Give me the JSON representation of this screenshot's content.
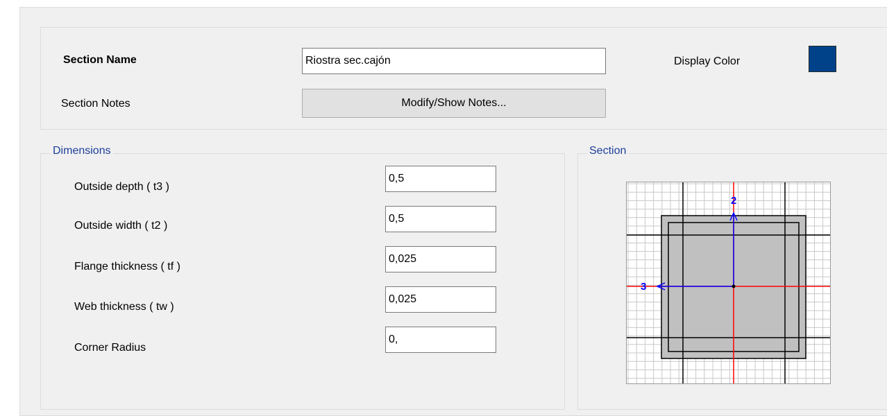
{
  "header": {
    "section_name_label": "Section Name",
    "section_name_value": "Riostra sec.cajón",
    "display_color_label": "Display Color",
    "display_color": "#00428a",
    "section_notes_label": "Section Notes",
    "notes_button_label": "Modify/Show Notes..."
  },
  "dimensions": {
    "title": "Dimensions",
    "fields": [
      {
        "label": "Outside depth  ( t3 )",
        "value": "0,5"
      },
      {
        "label": "Outside width  ( t2 )",
        "value": "0,5"
      },
      {
        "label": "Flange thickness  ( tf )",
        "value": "0,025"
      },
      {
        "label": "Web thickness  ( tw )",
        "value": "0,025"
      },
      {
        "label": "Corner Radius",
        "value": "0,"
      }
    ]
  },
  "section": {
    "title": "Section",
    "axis_2_label": "2",
    "axis_3_label": "3",
    "colors": {
      "grid_fine": "#c8c8c8",
      "grid_major": "#000000",
      "axis_center": "#ff0000",
      "local_axis": "#0000ff",
      "tube_outline": "#000000",
      "tube_fill": "#c0c0c0"
    }
  }
}
